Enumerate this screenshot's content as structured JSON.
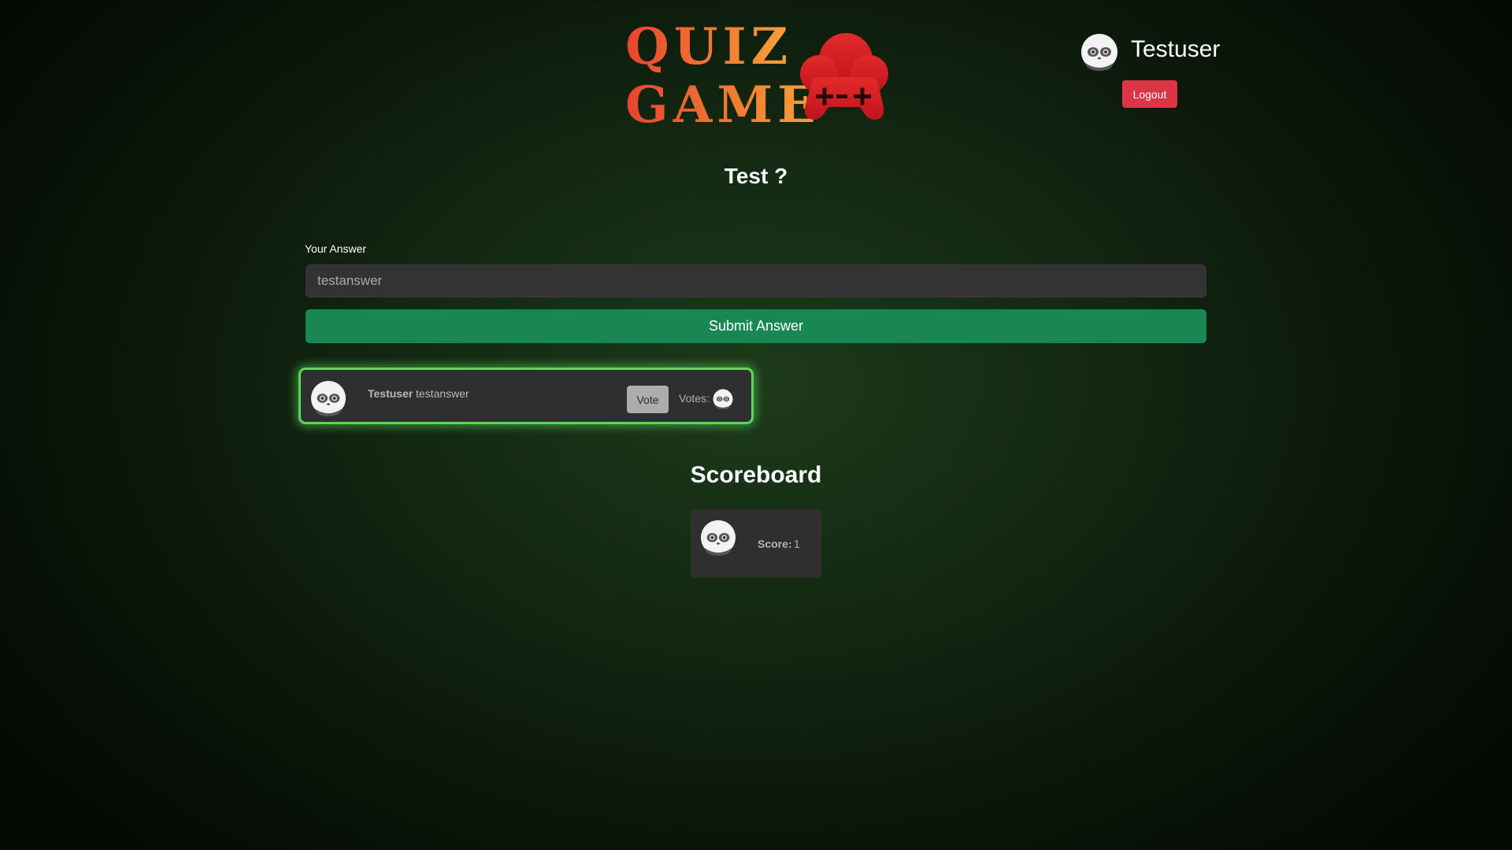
{
  "header": {
    "logo_line1": "QUIZ",
    "logo_line2": "GAME",
    "logo_icon": "gamepad-cloud-icon",
    "user": {
      "avatar_icon": "panda-avatar-icon",
      "name": "Testuser",
      "logout_label": "Logout"
    }
  },
  "question": {
    "text": "Test ?"
  },
  "answer_form": {
    "label": "Your Answer",
    "input_value": "testanswer",
    "submit_label": "Submit Answer"
  },
  "answers": [
    {
      "avatar_icon": "panda-avatar-icon",
      "user": "Testuser",
      "text": "testanswer",
      "vote_label": "Vote",
      "votes_label": "Votes:",
      "voter_avatar_icon": "panda-avatar-icon"
    }
  ],
  "scoreboard": {
    "title": "Scoreboard",
    "entries": [
      {
        "avatar_icon": "panda-avatar-icon",
        "score_label": "Score:",
        "score": "1"
      }
    ]
  },
  "colors": {
    "logo_gradient_start": "#e8432f",
    "logo_gradient_end": "#f6a33a",
    "controller_red": "#d81f26",
    "submit_green": "#198754",
    "logout_red": "#dc3545",
    "highlight_glow": "#5fd55f",
    "card_bg": "#2f2f2f"
  }
}
